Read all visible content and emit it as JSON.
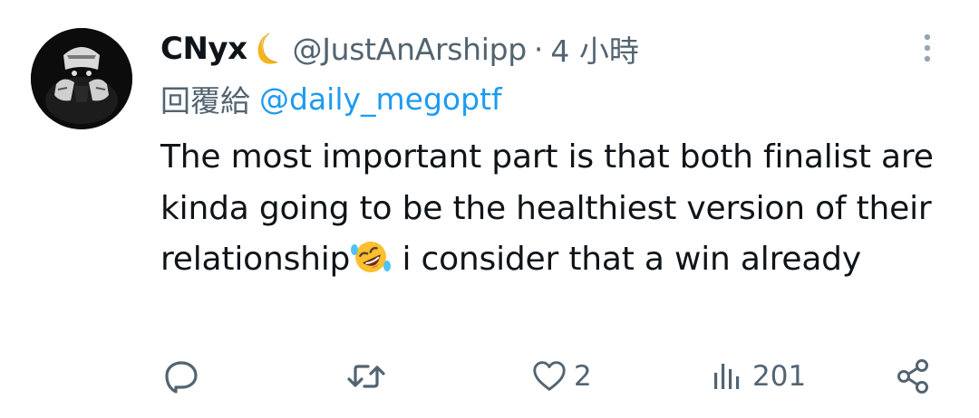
{
  "author": {
    "display_name": "CNyx",
    "handle": "@JustAnArshipp",
    "separator": "·",
    "time": "4 小時",
    "avatar_icon": "avatar-image",
    "badge_icon": "crescent-moon-emoji"
  },
  "reply": {
    "prefix": "回覆給",
    "to_handle": "@daily_megoptf"
  },
  "tweet": {
    "text_before_emoji": "The most important part is that both finalist are kinda going to be the healthiest version of their relationship",
    "emoji": "rolling-on-floor-laughing-emoji",
    "text_after_emoji": " i consider that a win already"
  },
  "actions": {
    "reply": {
      "icon": "reply-icon",
      "count": ""
    },
    "retweet": {
      "icon": "retweet-icon",
      "count": ""
    },
    "like": {
      "icon": "heart-icon",
      "count": "2"
    },
    "views": {
      "icon": "views-icon",
      "count": "201"
    },
    "share": {
      "icon": "share-icon",
      "count": ""
    }
  },
  "colors": {
    "text_primary": "#0f1419",
    "text_secondary": "#536471",
    "link": "#1d9bf0",
    "background": "#ffffff"
  }
}
